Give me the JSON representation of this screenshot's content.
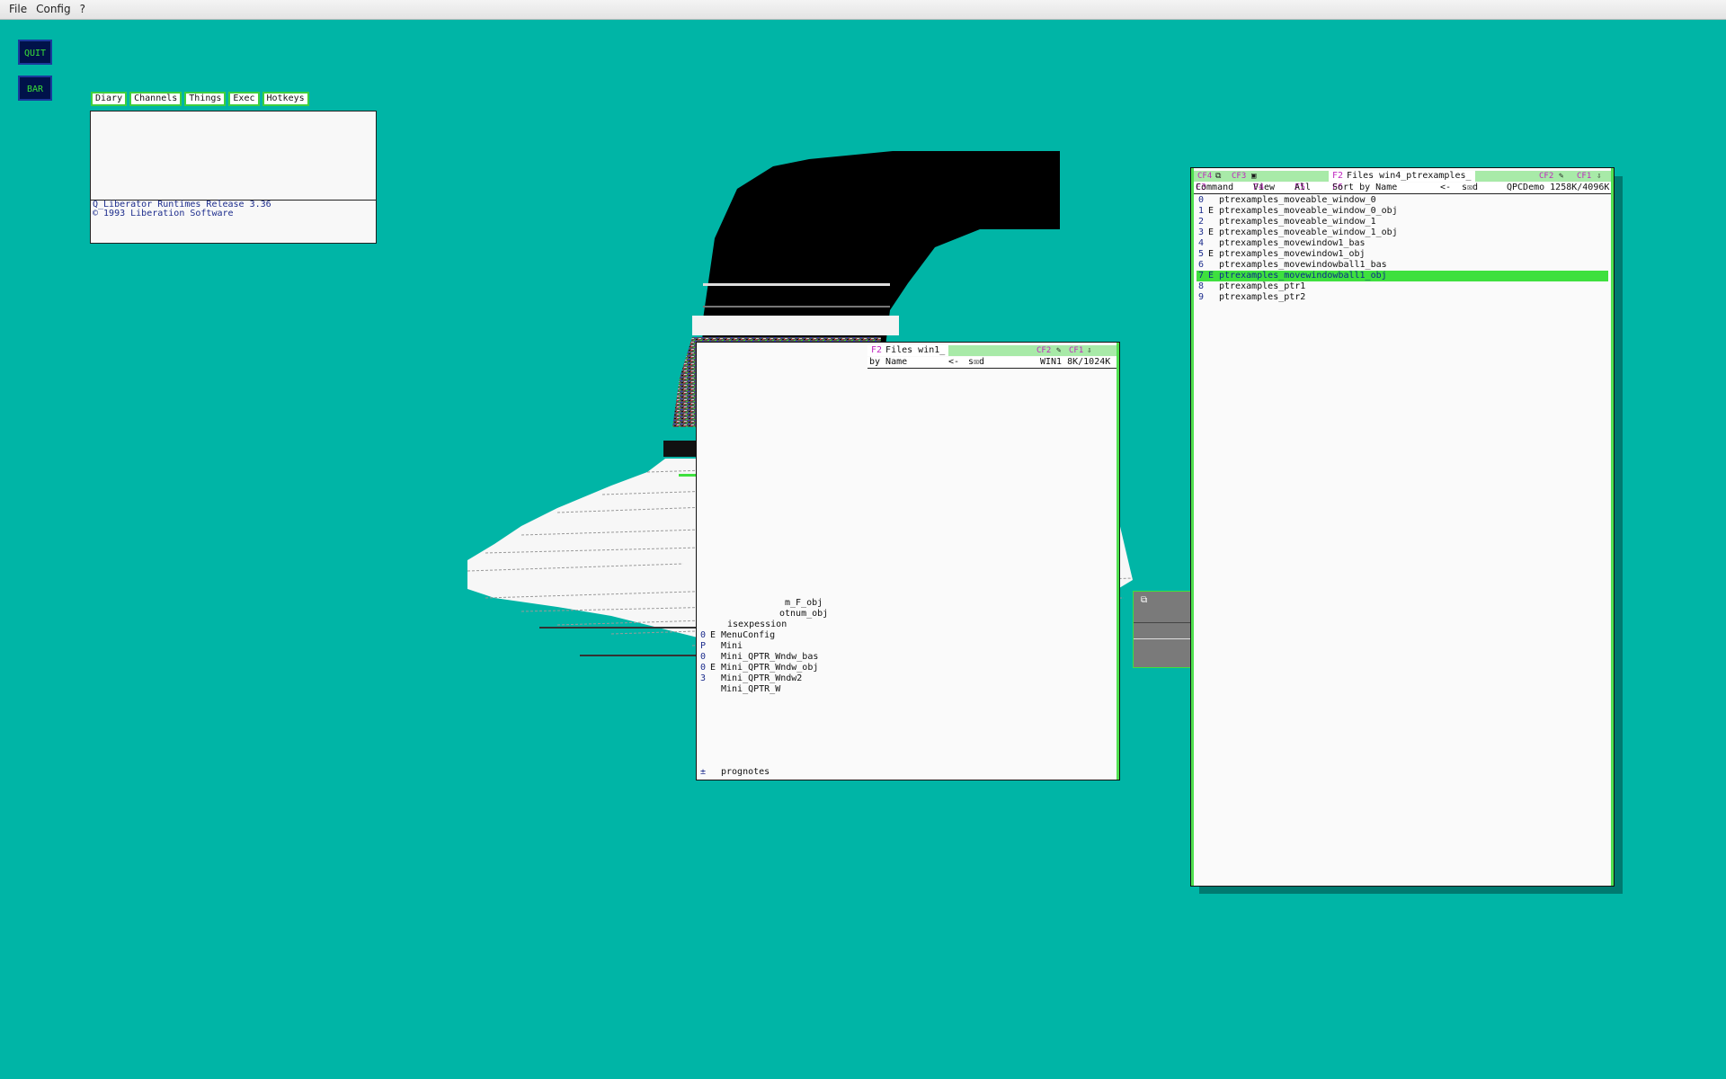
{
  "menubar": {
    "file": "File",
    "config": "Config",
    "help": "?"
  },
  "buttons": {
    "quit": "QUIT",
    "bar": "BAR"
  },
  "tabs": [
    "Diary",
    "Channels",
    "Things",
    "Exec",
    "Hotkeys"
  ],
  "console": {
    "line1": "Q_Liberator Runtimes Release 3.36",
    "line2": "© 1993 Liberation Software"
  },
  "win4": {
    "f4": "CF4",
    "f3": "CF3",
    "f2key": "F2",
    "title": "Files win4_ptrexamples_",
    "cf2": "CF2",
    "cf1": "CF1",
    "cmd": {
      "f3": "F3",
      "command": "Command",
      "f4": "F4",
      "view": "View",
      "f5": "F5",
      "all": "All",
      "f6": "F6",
      "sort": "Sort by Name",
      "back": "<-",
      "sd": "s☒d",
      "status": "QPCDemo 1258K/4096K"
    },
    "rows": [
      {
        "idx": "0",
        "flag": "",
        "name": "ptrexamples_moveable_window_0"
      },
      {
        "idx": "1",
        "flag": "E",
        "name": "ptrexamples_moveable_window_0_obj"
      },
      {
        "idx": "2",
        "flag": "",
        "name": "ptrexamples_moveable_window_1"
      },
      {
        "idx": "3",
        "flag": "E",
        "name": "ptrexamples_moveable_window_1_obj"
      },
      {
        "idx": "4",
        "flag": "",
        "name": "ptrexamples_movewindow1_bas"
      },
      {
        "idx": "5",
        "flag": "E",
        "name": "ptrexamples_movewindow1_obj"
      },
      {
        "idx": "6",
        "flag": "",
        "name": "ptrexamples_movewindowball1_bas"
      },
      {
        "idx": "7",
        "flag": "E",
        "name": "ptrexamples_movewindowball1_obj"
      },
      {
        "idx": "8",
        "flag": "",
        "name": "ptrexamples_ptr1"
      },
      {
        "idx": "9",
        "flag": "",
        "name": "ptrexamples_ptr2"
      }
    ]
  },
  "win1": {
    "f2key": "F2",
    "title": "Files win1_",
    "cf2": "CF2",
    "cf1": "CF1",
    "cmd": {
      "sort": "by Name",
      "back": "<-",
      "sd": "s☒d",
      "status": "WIN1 8K/1024K"
    },
    "rows": [
      {
        "idx": "",
        "flag": "",
        "name": "m_F_obj"
      },
      {
        "idx": "",
        "flag": "",
        "name": "otnum_obj"
      },
      {
        "idx": "",
        "flag": "",
        "name": "isexpession"
      },
      {
        "idx": "0",
        "flag": "E",
        "name": "MenuConfig"
      },
      {
        "idx": "P",
        "flag": "",
        "name": "Mini"
      },
      {
        "idx": "0",
        "flag": "",
        "name": "Mini_QPTR_Wndw_bas"
      },
      {
        "idx": "0",
        "flag": "E",
        "name": "Mini_QPTR_Wndw_obj"
      },
      {
        "idx": "3",
        "flag": "",
        "name": "Mini_QPTR_Wndw2"
      },
      {
        "idx": "",
        "flag": "",
        "name": "Mini_QPTR_W"
      }
    ],
    "last": {
      "idx": "±",
      "name": "prognotes"
    }
  },
  "colors": {
    "desktop": "#00b5a6",
    "accent": "#3ee03e",
    "button_bg": "#00124a"
  }
}
